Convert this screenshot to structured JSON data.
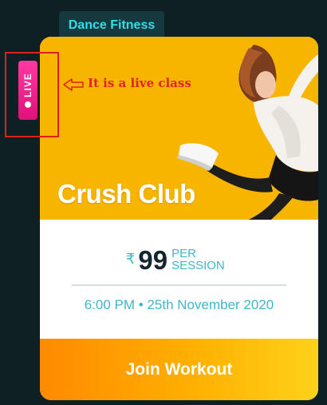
{
  "category": {
    "label": "Dance Fitness"
  },
  "class_card": {
    "title": "Crush Club",
    "live_badge": "LIVE",
    "price": {
      "currency_symbol": "₹",
      "amount": "99",
      "unit": "PER SESSION"
    },
    "schedule": "6:00 PM • 25th November 2020",
    "join_button": "Join Workout"
  },
  "annotation": {
    "text": "It is a live class"
  },
  "colors": {
    "background": "#0f2024",
    "tag_text": "#2fe0e6",
    "hero_yellow": "#f7b500",
    "accent_teal": "#3fb6c8",
    "live_pink": "#e0117a",
    "cta_orange": "#ff8a00",
    "annotation_red": "#e02020"
  }
}
